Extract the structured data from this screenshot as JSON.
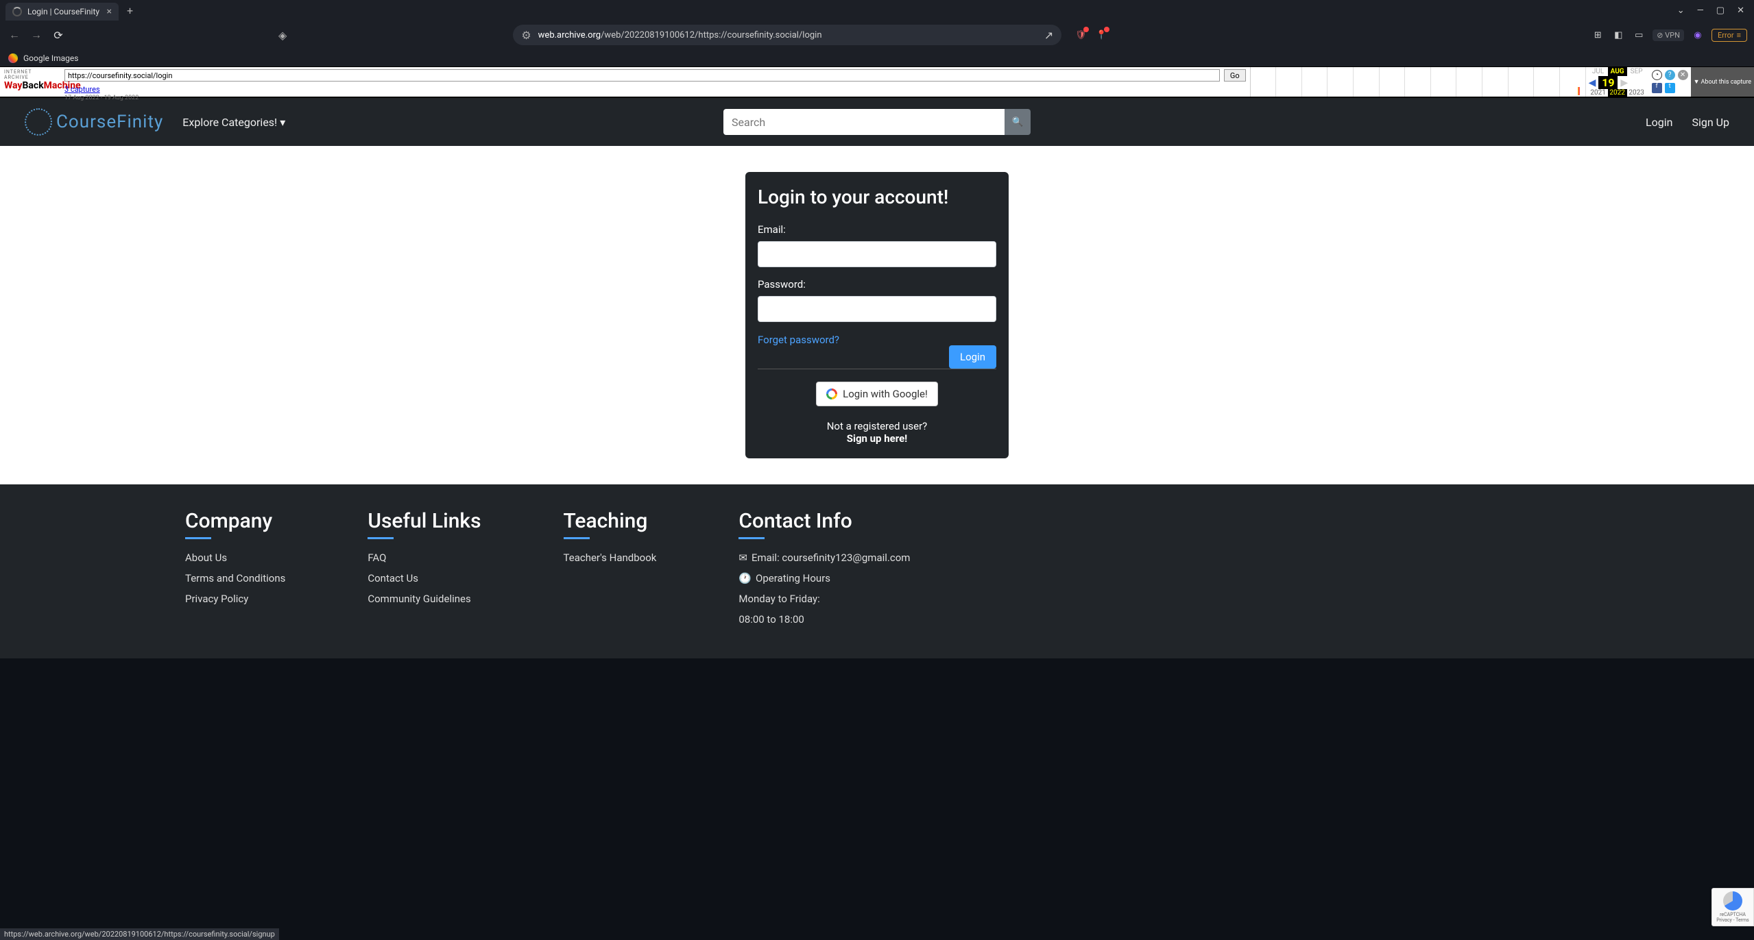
{
  "browser": {
    "tab_title": "Login | CourseFinity",
    "url_prefix": "web.archive.org",
    "url_path": "/web/20220819100612/https://coursefinity.social/login",
    "bookmark": "Google Images",
    "vpn_label": "VPN",
    "error_label": "Error",
    "status_url": "https://web.archive.org/web/20220819100612/https://coursefinity.social/signup"
  },
  "wayback": {
    "url_value": "https://coursefinity.social/login",
    "go_label": "Go",
    "captures_link": "3 captures",
    "date_range": "17 Aug 2022 - 19 Aug 2022",
    "prev_month": "JUL",
    "curr_month": "AUG",
    "next_month": "SEP",
    "day": "19",
    "prev_year": "2021",
    "curr_year": "2022",
    "next_year": "2023",
    "about_label": "About this capture"
  },
  "nav": {
    "logo_text": "CourseFinity",
    "explore_label": "Explore Categories!",
    "search_placeholder": "Search",
    "login_label": "Login",
    "signup_label": "Sign Up"
  },
  "login_form": {
    "title": "Login to your account!",
    "email_label": "Email:",
    "password_label": "Password:",
    "forget_label": "Forget password?",
    "login_button": "Login",
    "google_button": "Login with Google!",
    "not_registered": "Not a registered user?",
    "signup_here": "Sign up here!"
  },
  "footer": {
    "company": {
      "heading": "Company",
      "links": [
        "About Us",
        "Terms and Conditions",
        "Privacy Policy"
      ]
    },
    "useful": {
      "heading": "Useful Links",
      "links": [
        "FAQ",
        "Contact Us",
        "Community Guidelines"
      ]
    },
    "teaching": {
      "heading": "Teaching",
      "links": [
        "Teacher's Handbook"
      ]
    },
    "contact": {
      "heading": "Contact Info",
      "email_label": "Email: coursefinity123@gmail.com",
      "hours_label": "Operating Hours",
      "days_label": "Monday to Friday:",
      "time_label": "08:00 to 18:00"
    }
  },
  "recaptcha": {
    "label": "reCAPTCHA",
    "terms": "Privacy - Terms"
  }
}
